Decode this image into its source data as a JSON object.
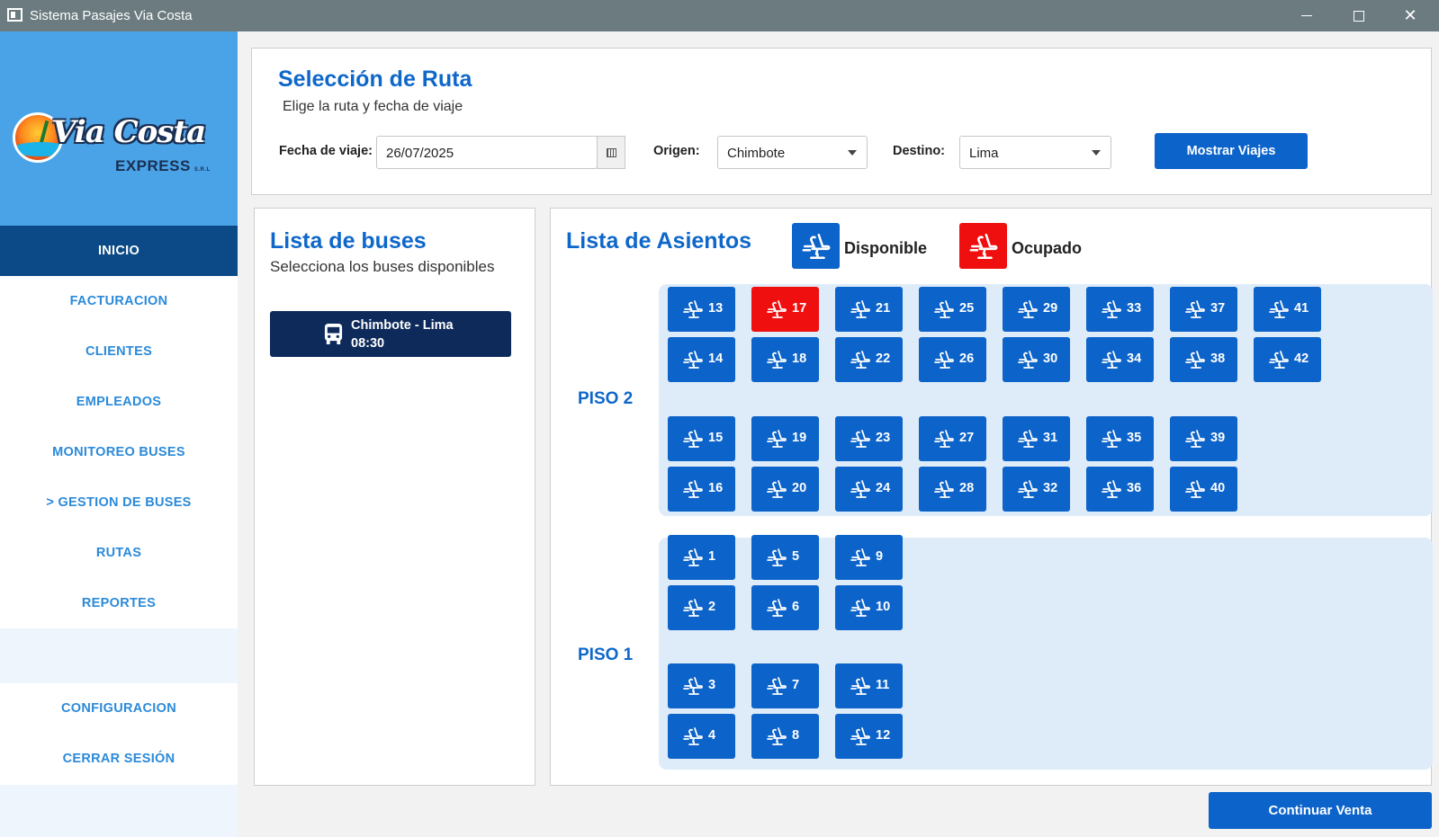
{
  "window": {
    "title": "Sistema Pasajes Via Costa"
  },
  "logo": {
    "brand": "Via Costa",
    "sub": "EXPRESS",
    "suffix": "S.R.L"
  },
  "sidebar": {
    "items": [
      {
        "label": "INICIO",
        "active": true
      },
      {
        "label": "FACTURACION"
      },
      {
        "label": "CLIENTES"
      },
      {
        "label": "EMPLEADOS"
      },
      {
        "label": "MONITOREO BUSES"
      },
      {
        "label": "> GESTION DE BUSES"
      },
      {
        "label": "RUTAS"
      },
      {
        "label": "REPORTES"
      }
    ],
    "bottom": [
      {
        "label": "CONFIGURACION"
      },
      {
        "label": "CERRAR SESIÓN"
      }
    ]
  },
  "route": {
    "title": "Selección de Ruta",
    "subtitle": "Elige la ruta y fecha de viaje",
    "date_label": "Fecha de viaje:",
    "date_value": "26/07/2025",
    "origin_label": "Origen:",
    "origin_value": "Chimbote",
    "dest_label": "Destino:",
    "dest_value": "Lima",
    "show_button": "Mostrar Viajes"
  },
  "buses": {
    "title": "Lista de buses",
    "subtitle": "Selecciona los buses disponibles",
    "items": [
      {
        "route": "Chimbote - Lima",
        "time": "08:30"
      }
    ]
  },
  "seats": {
    "title": "Lista de Asientos",
    "legend_available": "Disponible",
    "legend_occupied": "Ocupado",
    "colors": {
      "available": "#0c63c9",
      "occupied": "#f00f0f"
    },
    "floor2_label": "PISO 2",
    "floor1_label": "PISO 1",
    "occupied": [
      17
    ],
    "floor2_rows": [
      [
        13,
        17,
        21,
        25,
        29,
        33,
        37,
        41
      ],
      [
        14,
        18,
        22,
        26,
        30,
        34,
        38,
        42
      ],
      [
        15,
        19,
        23,
        27,
        31,
        35,
        39
      ],
      [
        16,
        20,
        24,
        28,
        32,
        36,
        40
      ]
    ],
    "floor1_rows": [
      [
        1,
        5,
        9
      ],
      [
        2,
        6,
        10
      ],
      [
        3,
        7,
        11
      ],
      [
        4,
        8,
        12
      ]
    ]
  },
  "continue_button": "Continuar Venta"
}
